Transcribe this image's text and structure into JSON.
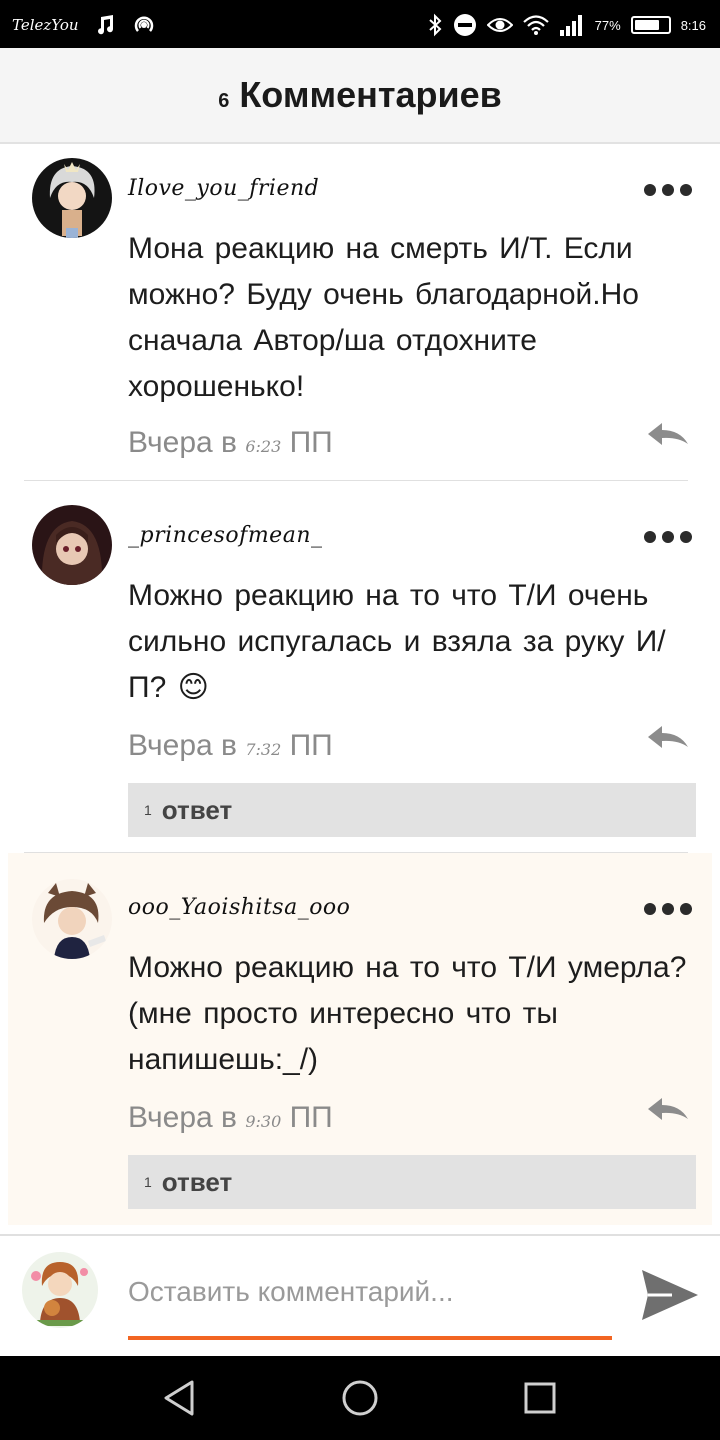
{
  "status_bar": {
    "carrier": "TelezYou",
    "battery": "77%",
    "battery_level": 0.77,
    "time": "8:16"
  },
  "header": {
    "count": "6",
    "title": "Комментариев"
  },
  "comments": [
    {
      "username": "Ilove_you_friend",
      "text": "Мона реакцию на смерть И/Т. Если можно? Буду очень благодарной.Но сначала Автор/ша отдохните хорошенько!",
      "time_prefix": "Вчера в",
      "time_value": "6:23",
      "time_suffix": "ПП"
    },
    {
      "username": "_princesofmean_",
      "text": "Можно реакцию на то что Т/И очень сильно испугалась и взяла за руку И/П? 😊",
      "time_prefix": "Вчера в",
      "time_value": "7:32",
      "time_suffix": "ПП",
      "replies_count": "1",
      "replies_label": "ответ"
    },
    {
      "username": "ooo_Yaoishitsa_ooo",
      "text": "Можно реакцию на то что Т/И умерла? (мне просто интересно что ты напишешь:_/)",
      "time_prefix": "Вчера в",
      "time_value": "9:30",
      "time_suffix": "ПП",
      "replies_count": "1",
      "replies_label": "ответ"
    }
  ],
  "input": {
    "placeholder": "Оставить комментарий..."
  },
  "colors": {
    "accent": "#f26522",
    "highlight_bg": "#fef9f2",
    "replies_bg": "#e2e2e2"
  },
  "icons": [
    "music-note-icon",
    "broadcast-icon",
    "bluetooth-icon",
    "dnd-icon",
    "eye-icon",
    "wifi-icon",
    "signal-icon",
    "battery-icon",
    "more-icon",
    "reply-icon",
    "send-icon",
    "back-icon",
    "home-icon",
    "recents-icon"
  ]
}
